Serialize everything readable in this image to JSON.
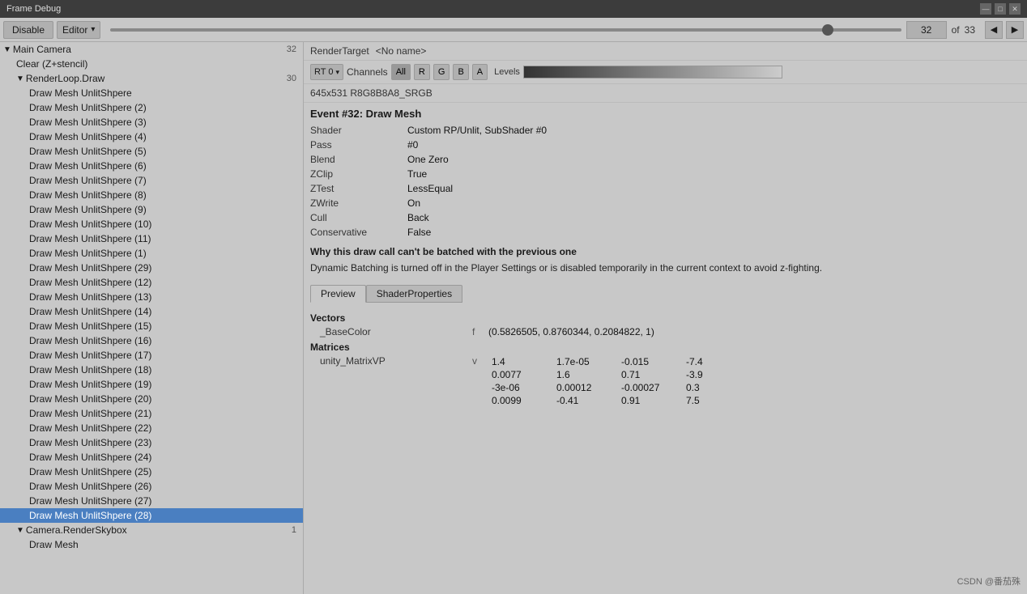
{
  "titlebar": {
    "title": "Frame Debug"
  },
  "toolbar": {
    "disable_label": "Disable",
    "editor_label": "Editor",
    "slider_value": 90,
    "frame_number": "32",
    "frame_total": "33",
    "nav_left": "◀",
    "nav_right": "▶",
    "of_label": "of"
  },
  "left_panel": {
    "items": [
      {
        "label": "Main Camera",
        "level": 0,
        "arrow": "▼",
        "num": "32",
        "selected": false
      },
      {
        "label": "Clear (Z+stencil)",
        "level": 1,
        "arrow": "",
        "num": "",
        "selected": false
      },
      {
        "label": "RenderLoop.Draw",
        "level": 1,
        "arrow": "▼",
        "num": "30",
        "selected": false
      },
      {
        "label": "Draw Mesh UnlitShpere",
        "level": 2,
        "arrow": "",
        "num": "",
        "selected": false
      },
      {
        "label": "Draw Mesh UnlitShpere (2)",
        "level": 2,
        "arrow": "",
        "num": "",
        "selected": false
      },
      {
        "label": "Draw Mesh UnlitShpere (3)",
        "level": 2,
        "arrow": "",
        "num": "",
        "selected": false
      },
      {
        "label": "Draw Mesh UnlitShpere (4)",
        "level": 2,
        "arrow": "",
        "num": "",
        "selected": false
      },
      {
        "label": "Draw Mesh UnlitShpere (5)",
        "level": 2,
        "arrow": "",
        "num": "",
        "selected": false
      },
      {
        "label": "Draw Mesh UnlitShpere (6)",
        "level": 2,
        "arrow": "",
        "num": "",
        "selected": false
      },
      {
        "label": "Draw Mesh UnlitShpere (7)",
        "level": 2,
        "arrow": "",
        "num": "",
        "selected": false
      },
      {
        "label": "Draw Mesh UnlitShpere (8)",
        "level": 2,
        "arrow": "",
        "num": "",
        "selected": false
      },
      {
        "label": "Draw Mesh UnlitShpere (9)",
        "level": 2,
        "arrow": "",
        "num": "",
        "selected": false
      },
      {
        "label": "Draw Mesh UnlitShpere (10)",
        "level": 2,
        "arrow": "",
        "num": "",
        "selected": false
      },
      {
        "label": "Draw Mesh UnlitShpere (11)",
        "level": 2,
        "arrow": "",
        "num": "",
        "selected": false
      },
      {
        "label": "Draw Mesh UnlitShpere (1)",
        "level": 2,
        "arrow": "",
        "num": "",
        "selected": false
      },
      {
        "label": "Draw Mesh UnlitShpere (29)",
        "level": 2,
        "arrow": "",
        "num": "",
        "selected": false
      },
      {
        "label": "Draw Mesh UnlitShpere (12)",
        "level": 2,
        "arrow": "",
        "num": "",
        "selected": false
      },
      {
        "label": "Draw Mesh UnlitShpere (13)",
        "level": 2,
        "arrow": "",
        "num": "",
        "selected": false
      },
      {
        "label": "Draw Mesh UnlitShpere (14)",
        "level": 2,
        "arrow": "",
        "num": "",
        "selected": false
      },
      {
        "label": "Draw Mesh UnlitShpere (15)",
        "level": 2,
        "arrow": "",
        "num": "",
        "selected": false
      },
      {
        "label": "Draw Mesh UnlitShpere (16)",
        "level": 2,
        "arrow": "",
        "num": "",
        "selected": false
      },
      {
        "label": "Draw Mesh UnlitShpere (17)",
        "level": 2,
        "arrow": "",
        "num": "",
        "selected": false
      },
      {
        "label": "Draw Mesh UnlitShpere (18)",
        "level": 2,
        "arrow": "",
        "num": "",
        "selected": false
      },
      {
        "label": "Draw Mesh UnlitShpere (19)",
        "level": 2,
        "arrow": "",
        "num": "",
        "selected": false
      },
      {
        "label": "Draw Mesh UnlitShpere (20)",
        "level": 2,
        "arrow": "",
        "num": "",
        "selected": false
      },
      {
        "label": "Draw Mesh UnlitShpere (21)",
        "level": 2,
        "arrow": "",
        "num": "",
        "selected": false
      },
      {
        "label": "Draw Mesh UnlitShpere (22)",
        "level": 2,
        "arrow": "",
        "num": "",
        "selected": false
      },
      {
        "label": "Draw Mesh UnlitShpere (23)",
        "level": 2,
        "arrow": "",
        "num": "",
        "selected": false
      },
      {
        "label": "Draw Mesh UnlitShpere (24)",
        "level": 2,
        "arrow": "",
        "num": "",
        "selected": false
      },
      {
        "label": "Draw Mesh UnlitShpere (25)",
        "level": 2,
        "arrow": "",
        "num": "",
        "selected": false
      },
      {
        "label": "Draw Mesh UnlitShpere (26)",
        "level": 2,
        "arrow": "",
        "num": "",
        "selected": false
      },
      {
        "label": "Draw Mesh UnlitShpere (27)",
        "level": 2,
        "arrow": "",
        "num": "",
        "selected": false
      },
      {
        "label": "Draw Mesh UnlitShpere (28)",
        "level": 2,
        "arrow": "",
        "num": "",
        "selected": true
      },
      {
        "label": "Camera.RenderSkybox",
        "level": 1,
        "arrow": "▼",
        "num": "1",
        "selected": false
      },
      {
        "label": "Draw Mesh",
        "level": 2,
        "arrow": "",
        "num": "",
        "selected": false
      }
    ]
  },
  "right_panel": {
    "render_target_label": "RenderTarget",
    "render_target_name": "<No name>",
    "rt_dropdown": "RT 0",
    "channels_label": "Channels",
    "channel_all": "All",
    "channel_r": "R",
    "channel_g": "G",
    "channel_b": "B",
    "channel_a": "A",
    "levels_label": "Levels",
    "info_text": "645x531 R8G8B8A8_SRGB",
    "event_header": "Event #32: Draw Mesh",
    "details": [
      {
        "key": "Shader",
        "value": "Custom RP/Unlit, SubShader #0"
      },
      {
        "key": "Pass",
        "value": "#0"
      },
      {
        "key": "Blend",
        "value": "One Zero"
      },
      {
        "key": "ZClip",
        "value": "True"
      },
      {
        "key": "ZTest",
        "value": "LessEqual"
      },
      {
        "key": "ZWrite",
        "value": "On"
      },
      {
        "key": "Cull",
        "value": "Back"
      },
      {
        "key": "Conservative",
        "value": "False"
      }
    ],
    "batching_warn_title": "Why this draw call can't be batched with the previous one",
    "batching_warn_body": "Dynamic Batching is turned off in the Player Settings or is disabled temporarily in the current context to avoid z-fighting.",
    "tabs": [
      {
        "label": "Preview",
        "active": true
      },
      {
        "label": "ShaderProperties",
        "active": false
      }
    ],
    "vectors_header": "Vectors",
    "basecolor_name": "_BaseColor",
    "basecolor_type": "f",
    "basecolor_value": "(0.5826505, 0.8760344, 0.2084822, 1)",
    "matrices_header": "Matrices",
    "matrix_name": "unity_MatrixVP",
    "matrix_type": "v",
    "matrix_rows": [
      [
        "1.4",
        "1.7e-05",
        "-0.015",
        "-7.4"
      ],
      [
        "0.0077",
        "1.6",
        "0.71",
        "-3.9"
      ],
      [
        "-3e-06",
        "0.00012",
        "-0.00027",
        "0.3"
      ],
      [
        "0.0099",
        "-0.41",
        "0.91",
        "7.5"
      ]
    ]
  },
  "watermark": "CSDN @番茄殊"
}
